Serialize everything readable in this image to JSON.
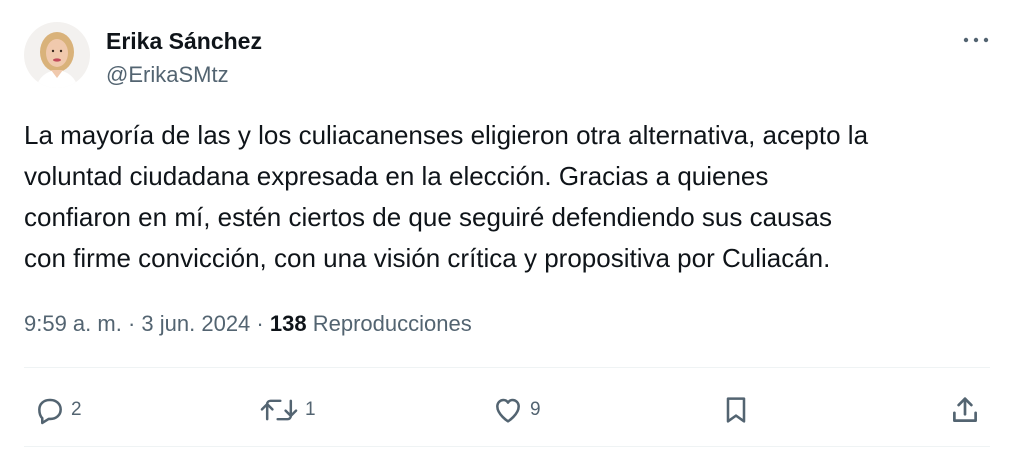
{
  "author": {
    "name": "Erika Sánchez",
    "handle": "@ErikaSMtz"
  },
  "tweet": {
    "lines": [
      "La mayoría de las y los culiacanenses eligieron otra alternativa, acepto la",
      "voluntad ciudadana expresada en la elección. Gracias a quienes",
      "confiaron en mí, estén ciertos de que seguiré defendiendo sus causas",
      "con firme convicción, con una visión crítica y propositiva por Culiacán."
    ],
    "time": "9:59 a. m.",
    "date": "3 jun. 2024",
    "separator": "·",
    "views_count": "138",
    "views_label": "Reproducciones"
  },
  "actions": {
    "replies": "2",
    "reposts": "1",
    "likes": "9"
  },
  "icons": {
    "avatar": "profile-photo",
    "more": "more-horizontal-icon",
    "reply": "reply-icon",
    "repost": "repost-icon",
    "like": "heart-icon",
    "bookmark": "bookmark-icon",
    "share": "share-icon"
  },
  "colors": {
    "text": "#0f1419",
    "secondary": "#536471",
    "divider": "#eff3f4"
  }
}
